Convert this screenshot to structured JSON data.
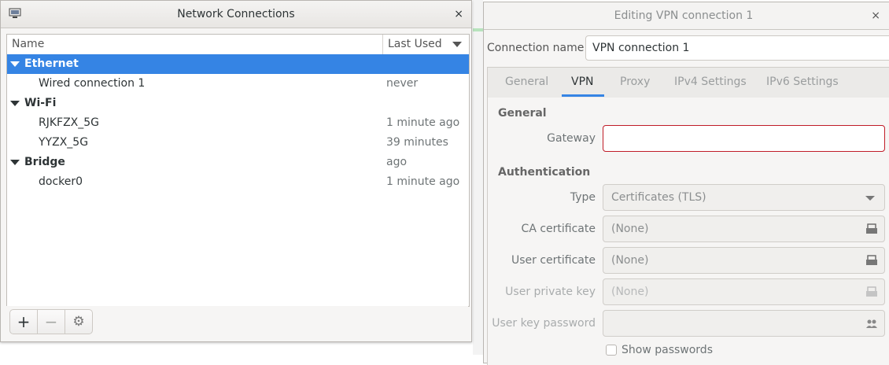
{
  "left_window": {
    "title": "Network Connections",
    "close_glyph": "×",
    "columns": {
      "name": "Name",
      "last_used": "Last Used"
    },
    "groups": [
      {
        "label": "Ethernet",
        "selected": true,
        "items": [
          {
            "name": "Wired connection 1",
            "last_used": "never"
          }
        ]
      },
      {
        "label": "Wi-Fi",
        "selected": false,
        "items": [
          {
            "name": "RJKFZX_5G",
            "last_used": "1 minute ago"
          },
          {
            "name": "YYZX_5G",
            "last_used": "39 minutes ago"
          }
        ]
      },
      {
        "label": "Bridge",
        "selected": false,
        "items": [
          {
            "name": "docker0",
            "last_used": "1 minute ago"
          }
        ]
      }
    ],
    "toolbar": {
      "add": "+",
      "remove": "−",
      "settings": "⚙"
    }
  },
  "right_window": {
    "title": "Editing VPN connection 1",
    "close_glyph": "×",
    "connection_name_label": "Connection name",
    "connection_name_value": "VPN connection 1",
    "tabs": [
      "General",
      "VPN",
      "Proxy",
      "IPv4 Settings",
      "IPv6 Settings"
    ],
    "active_tab": "VPN",
    "sections": {
      "general": "General",
      "authentication": "Authentication"
    },
    "fields": {
      "gateway": {
        "label": "Gateway",
        "value": ""
      },
      "type": {
        "label": "Type",
        "value": "Certificates (TLS)"
      },
      "ca_certificate": {
        "label": "CA certificate",
        "value": "(None)"
      },
      "user_certificate": {
        "label": "User certificate",
        "value": "(None)"
      },
      "user_private_key": {
        "label": "User private key",
        "value": "(None)"
      },
      "user_key_password": {
        "label": "User key password",
        "value": ""
      }
    },
    "show_passwords_label": "Show passwords"
  },
  "colors": {
    "accent": "#3584e4",
    "error": "#c01c28"
  }
}
